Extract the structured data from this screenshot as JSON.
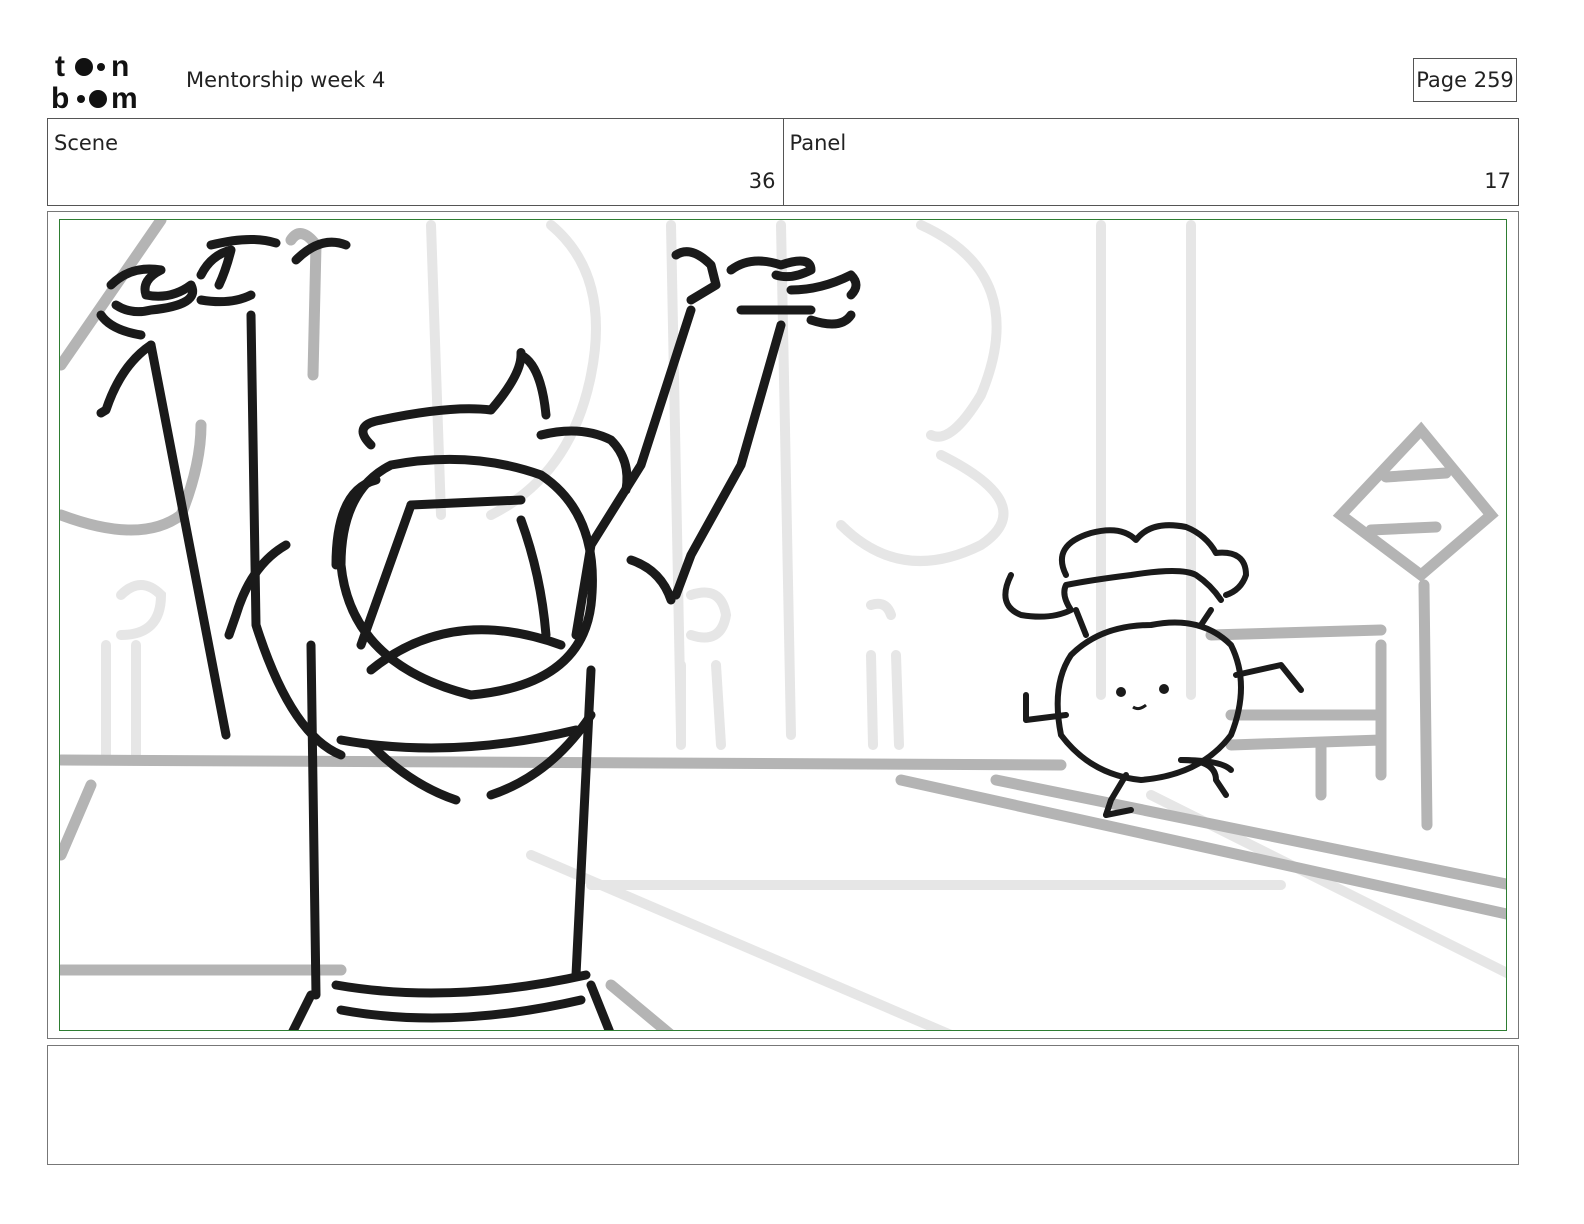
{
  "header": {
    "logo_text": "toon boom",
    "doc_title": "Mentorship week 4",
    "page_label": "Page 259"
  },
  "meta": {
    "scene_label": "Scene",
    "scene_value": "36",
    "panel_label": "Panel",
    "panel_value": "17"
  },
  "notes": {
    "text": ""
  },
  "colors": {
    "frame_border": "#2e7d32",
    "ink": "#1a1a1a",
    "background_ink": "#b0b0b0"
  }
}
